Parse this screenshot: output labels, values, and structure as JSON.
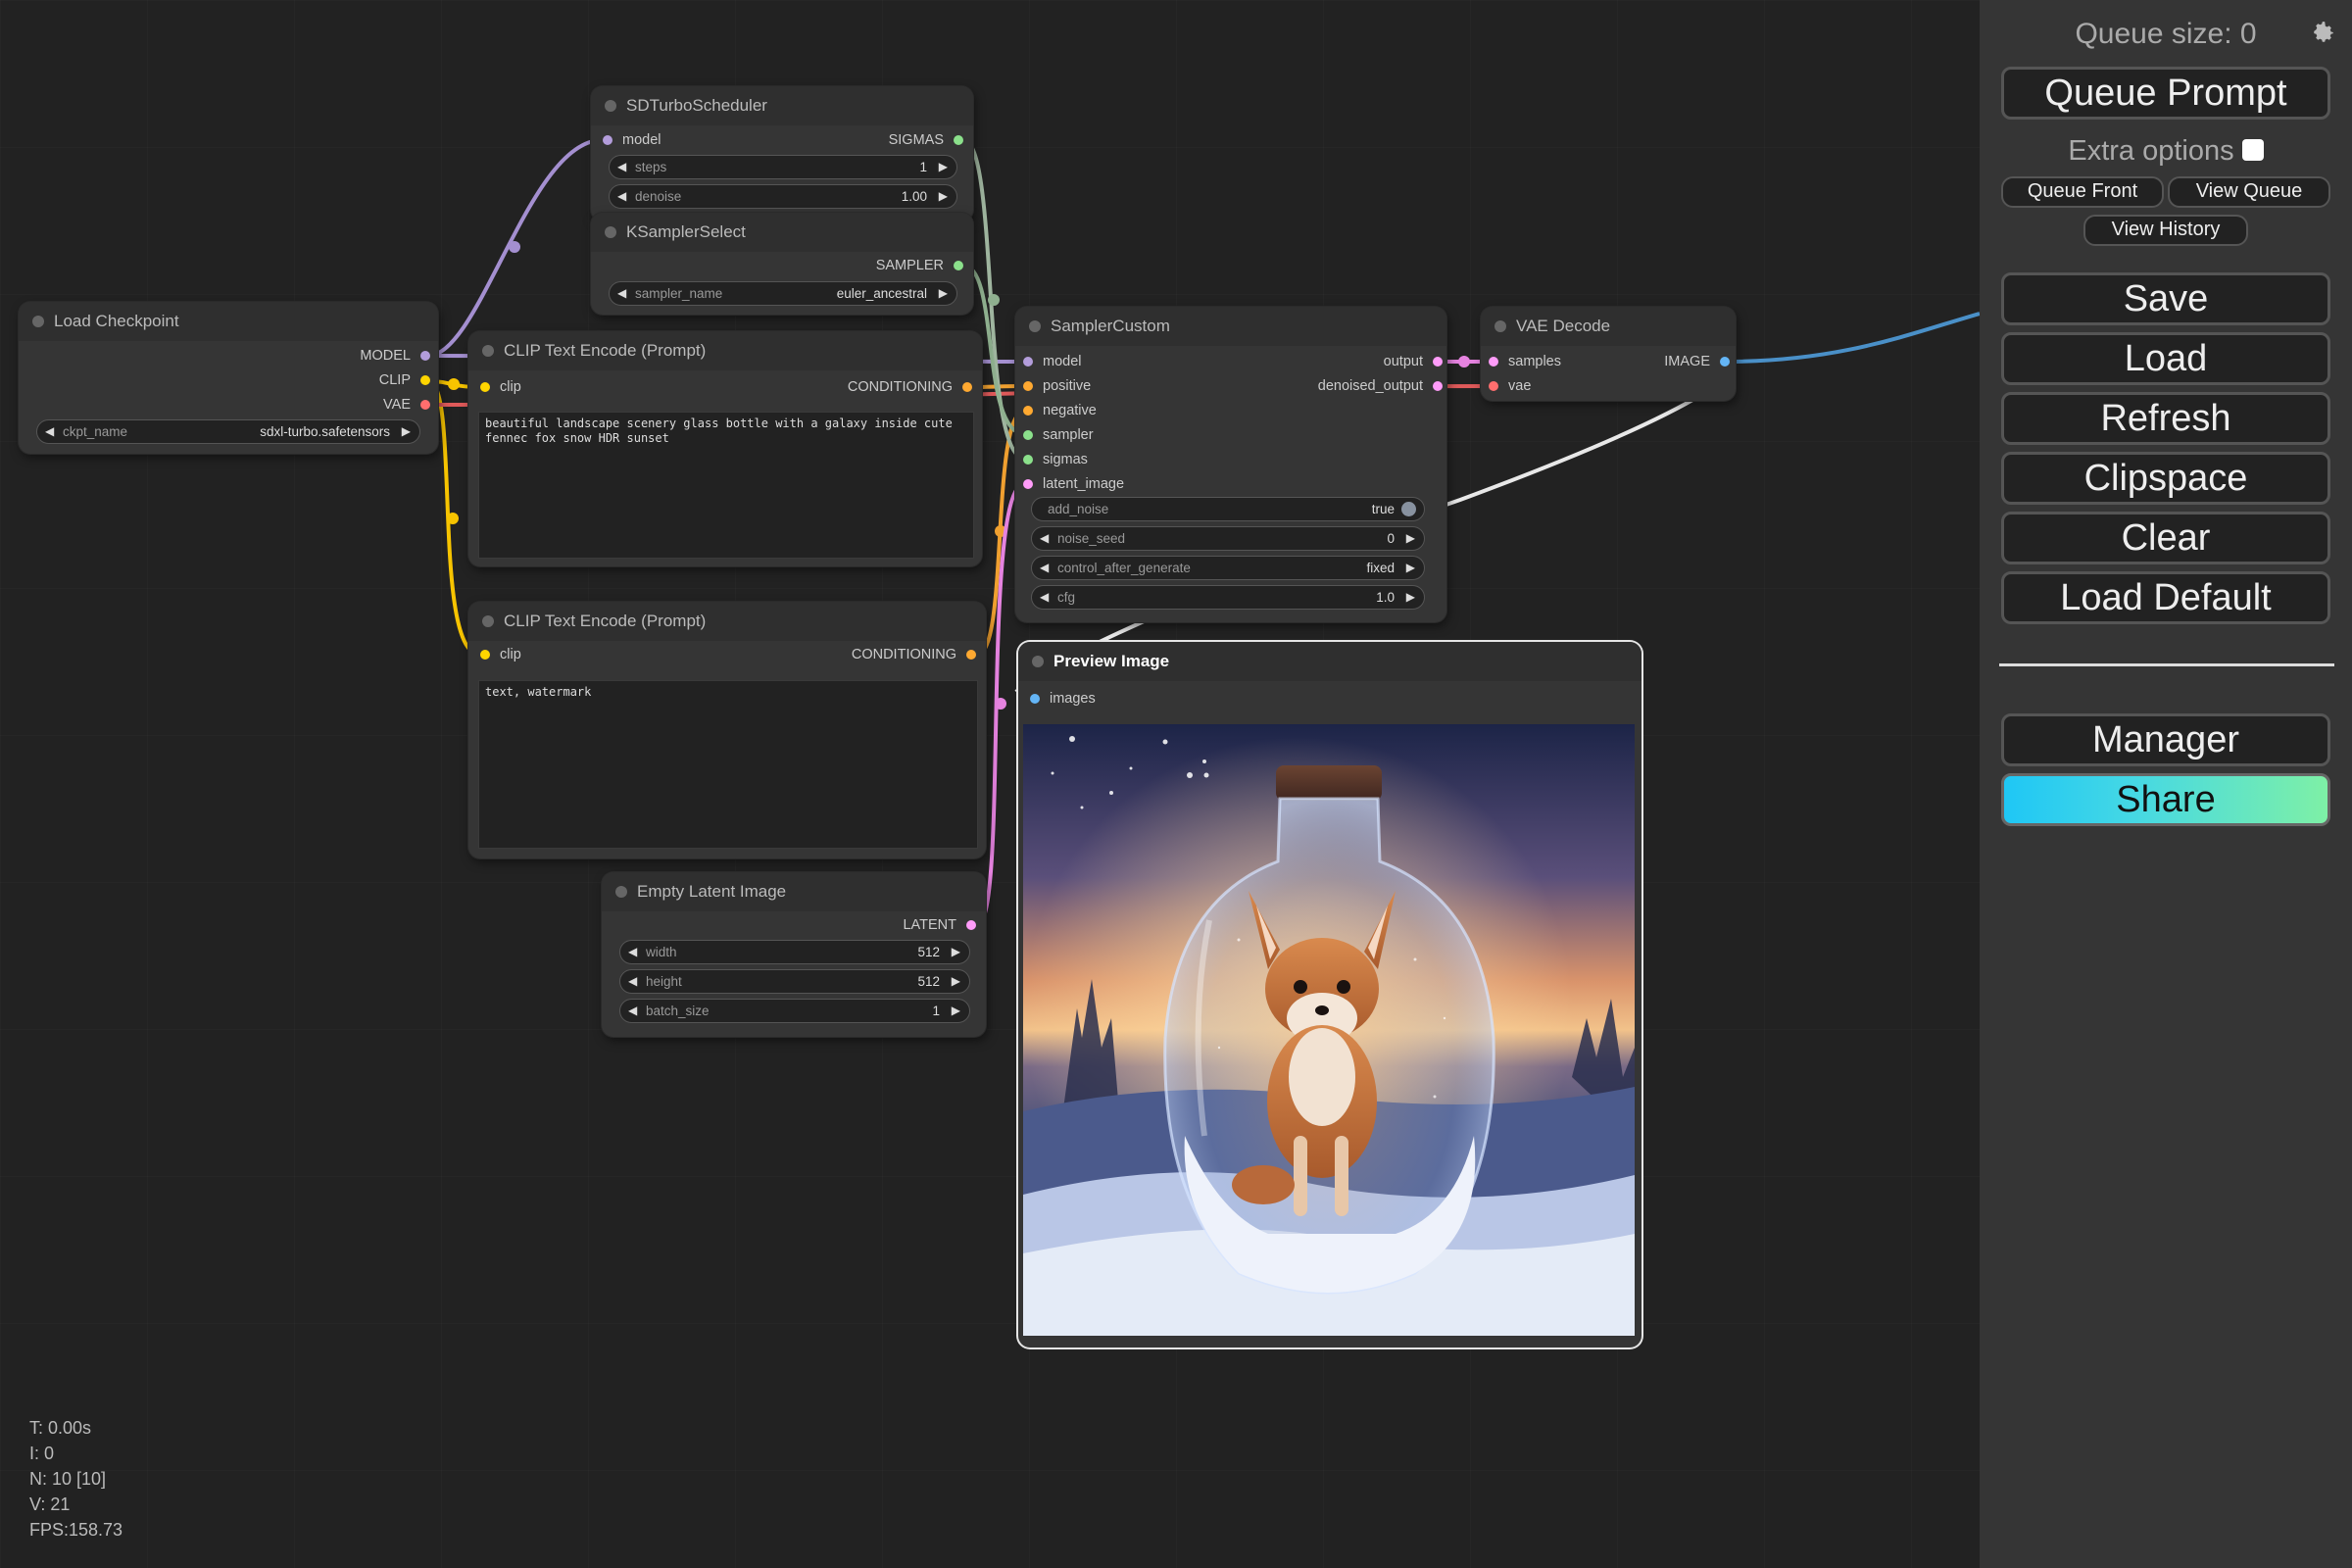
{
  "canvas": {
    "nodes": {
      "sd_turbo_scheduler": {
        "title": "SDTurboScheduler",
        "input_model": "model",
        "output_sigmas": "SIGMAS",
        "steps": {
          "label": "steps",
          "value": "1"
        },
        "denoise": {
          "label": "denoise",
          "value": "1.00"
        }
      },
      "ksampler_select": {
        "title": "KSamplerSelect",
        "output_sampler": "SAMPLER",
        "sampler_name": {
          "label": "sampler_name",
          "value": "euler_ancestral"
        }
      },
      "load_checkpoint": {
        "title": "Load Checkpoint",
        "output_model": "MODEL",
        "output_clip": "CLIP",
        "output_vae": "VAE",
        "ckpt_name": {
          "label": "ckpt_name",
          "value": "sdxl-turbo.safetensors"
        }
      },
      "clip_text_positive": {
        "title": "CLIP Text Encode (Prompt)",
        "input_clip": "clip",
        "output_conditioning": "CONDITIONING",
        "text": "beautiful landscape scenery glass bottle with a galaxy inside cute fennec fox snow HDR sunset"
      },
      "clip_text_negative": {
        "title": "CLIP Text Encode (Prompt)",
        "input_clip": "clip",
        "output_conditioning": "CONDITIONING",
        "text": "text, watermark"
      },
      "empty_latent": {
        "title": "Empty Latent Image",
        "output_latent": "LATENT",
        "width": {
          "label": "width",
          "value": "512"
        },
        "height": {
          "label": "height",
          "value": "512"
        },
        "batch_size": {
          "label": "batch_size",
          "value": "1"
        }
      },
      "sampler_custom": {
        "title": "SamplerCustom",
        "inputs": [
          "model",
          "positive",
          "negative",
          "sampler",
          "sigmas",
          "latent_image"
        ],
        "output_output": "output",
        "output_denoised": "denoised_output",
        "add_noise": {
          "label": "add_noise",
          "value": "true"
        },
        "noise_seed": {
          "label": "noise_seed",
          "value": "0"
        },
        "control_after_generate": {
          "label": "control_after_generate",
          "value": "fixed"
        },
        "cfg": {
          "label": "cfg",
          "value": "1.0"
        }
      },
      "vae_decode": {
        "title": "VAE Decode",
        "input_samples": "samples",
        "input_vae": "vae",
        "output_image": "IMAGE"
      },
      "preview_image": {
        "title": "Preview Image",
        "input_images": "images"
      }
    },
    "stats": {
      "t": "T: 0.00s",
      "i": "I: 0",
      "n": "N: 10 [10]",
      "v": "V: 21",
      "fps": "FPS:158.73"
    }
  },
  "panel": {
    "queue_size": "Queue size: 0",
    "queue_prompt": "Queue Prompt",
    "extra_options": "Extra options",
    "queue_front": "Queue Front",
    "view_queue": "View Queue",
    "view_history": "View History",
    "save": "Save",
    "load": "Load",
    "refresh": "Refresh",
    "clipspace": "Clipspace",
    "clear": "Clear",
    "load_default": "Load Default",
    "manager": "Manager",
    "share": "Share"
  },
  "colors": {
    "model": "#b39ddb",
    "clip": "#ffd500",
    "vae": "#ff6e6e",
    "conditioning": "#ffa931",
    "latent": "#ff9cf9",
    "sigmas": "#cdffcd",
    "sampler": "#a8e6a8",
    "image": "#64b5f6",
    "share_gradient_start": "#1fc7f5",
    "share_gradient_end": "#7ef0a6"
  }
}
